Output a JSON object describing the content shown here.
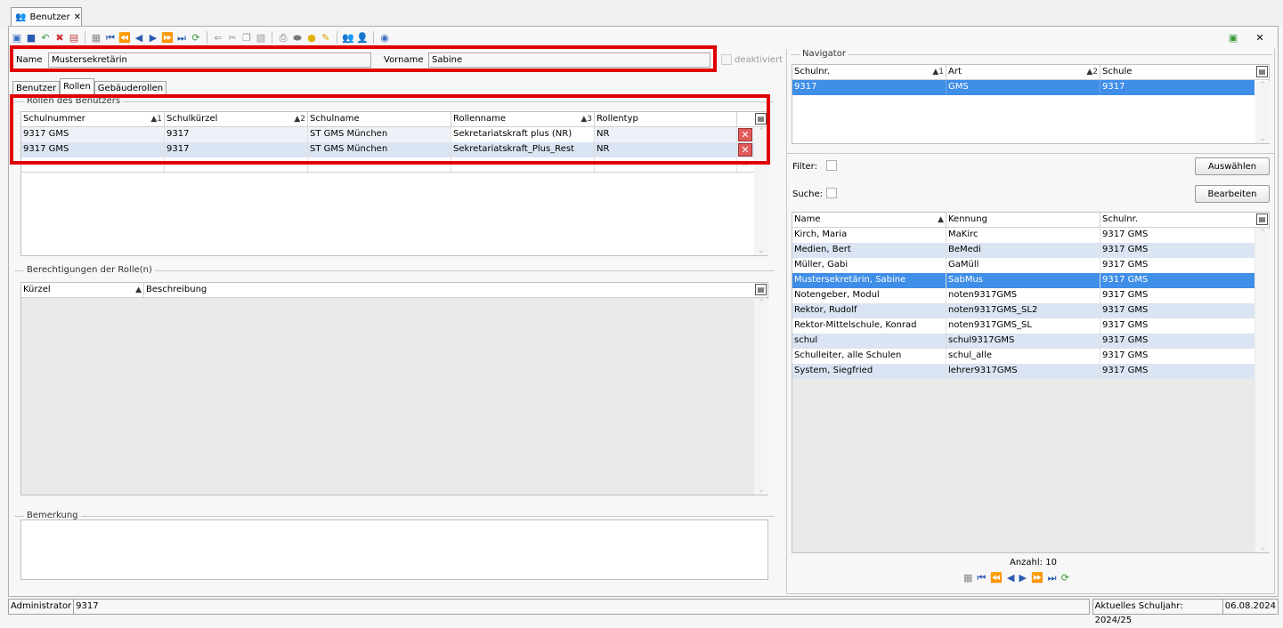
{
  "window": {
    "tab_title": "Benutzer",
    "close_glyph": "✕"
  },
  "colors": {
    "selection": "#3f8ee7",
    "alt_row": "#dbe4f3",
    "highlight": "#e00000"
  },
  "form": {
    "name_label": "Name",
    "name_value": "Mustersekretärin",
    "vorname_label": "Vorname",
    "vorname_value": "Sabine",
    "deaktiviert_label": "deaktiviert"
  },
  "subtabs": [
    "Benutzer",
    "Rollen",
    "Gebäuderollen"
  ],
  "roles": {
    "legend": "Rollen des Benutzers",
    "columns": [
      {
        "label": "Schulnummer",
        "sort": "1"
      },
      {
        "label": "Schulkürzel",
        "sort": "2"
      },
      {
        "label": "Schulname",
        "sort": ""
      },
      {
        "label": "Rollenname",
        "sort": "3"
      },
      {
        "label": "Rollentyp",
        "sort": ""
      }
    ],
    "rows": [
      [
        "9317 GMS",
        "9317",
        "ST GMS München",
        "Sekretariatskraft plus (NR)",
        "NR"
      ],
      [
        "9317 GMS",
        "9317",
        "ST GMS München",
        "Sekretariatskraft_Plus_Rest",
        "NR"
      ]
    ]
  },
  "perms": {
    "legend": "Berechtigungen der Rolle(n)",
    "columns": [
      "Kürzel",
      "Beschreibung"
    ]
  },
  "remark": {
    "legend": "Bemerkung"
  },
  "navigator": {
    "legend": "Navigator",
    "columns": [
      {
        "label": "Schulnr.",
        "sort": "1"
      },
      {
        "label": "Art",
        "sort": "2"
      },
      {
        "label": "Schule",
        "sort": ""
      }
    ],
    "rows": [
      [
        "9317",
        "GMS",
        "9317"
      ]
    ],
    "filter_label": "Filter:",
    "search_label": "Suche:",
    "select_button": "Auswählen",
    "edit_button": "Bearbeiten"
  },
  "users": {
    "columns": [
      "Name",
      "Kennung",
      "Schulnr."
    ],
    "rows": [
      [
        "Kirch, Maria",
        "MaKirc",
        "9317 GMS"
      ],
      [
        "Medien, Bert",
        "BeMedi",
        "9317 GMS"
      ],
      [
        "Müller, Gabi",
        "GaMüll",
        "9317 GMS"
      ],
      [
        "Mustersekretärin, Sabine",
        "SabMus",
        "9317 GMS"
      ],
      [
        "Notengeber, Modul",
        "noten9317GMS",
        "9317 GMS"
      ],
      [
        "Rektor, Rudolf",
        "noten9317GMS_SL2",
        "9317 GMS"
      ],
      [
        "Rektor-Mittelschule, Konrad",
        "noten9317GMS_SL",
        "9317 GMS"
      ],
      [
        "schul",
        "schul9317GMS",
        "9317 GMS"
      ],
      [
        "Schulleiter, alle Schulen",
        "schul_alle",
        "9317 GMS"
      ],
      [
        "System, Siegfried",
        "lehrer9317GMS",
        "9317 GMS"
      ]
    ],
    "selected_index": 3,
    "count_text": "Anzahl: 10"
  },
  "status": {
    "user": "Administrator",
    "school": "9317",
    "year": "Aktuelles Schuljahr: 2024/25",
    "date": "06.08.2024"
  }
}
